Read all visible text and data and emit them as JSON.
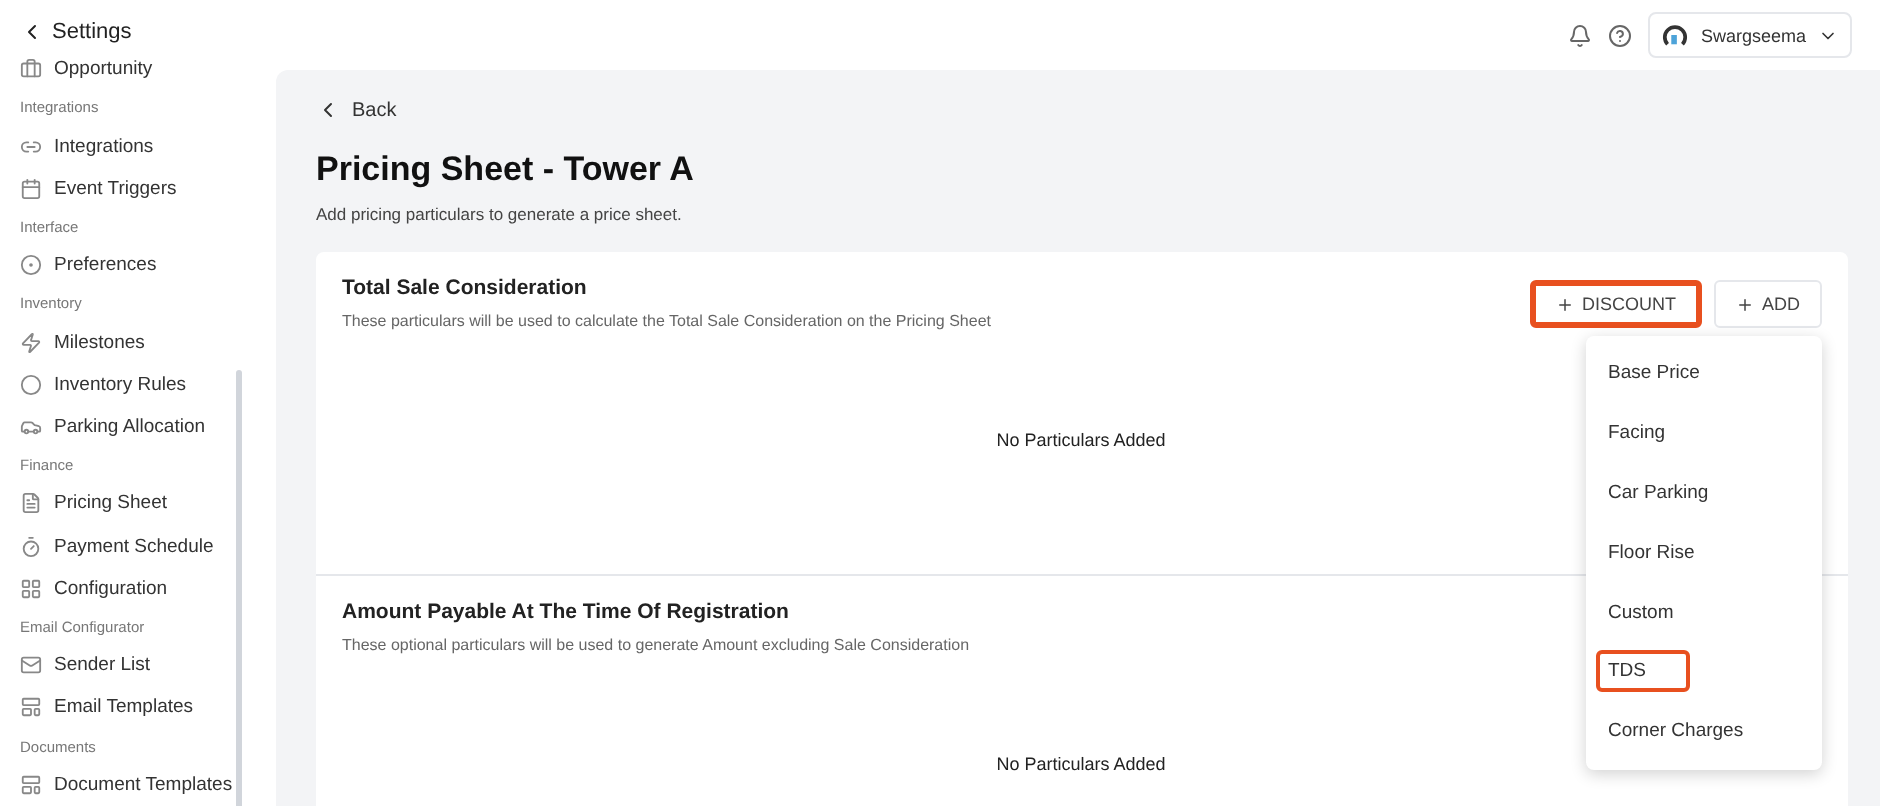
{
  "sidebar": {
    "back_label": "Settings",
    "items": [
      {
        "kind": "item",
        "label": "Opportunity"
      },
      {
        "kind": "section",
        "label": "Integrations"
      },
      {
        "kind": "item",
        "label": "Integrations"
      },
      {
        "kind": "item",
        "label": "Event Triggers"
      },
      {
        "kind": "section",
        "label": "Interface"
      },
      {
        "kind": "item",
        "label": "Preferences"
      },
      {
        "kind": "section",
        "label": "Inventory"
      },
      {
        "kind": "item",
        "label": "Milestones"
      },
      {
        "kind": "item",
        "label": "Inventory Rules"
      },
      {
        "kind": "item",
        "label": "Parking Allocation"
      },
      {
        "kind": "section",
        "label": "Finance"
      },
      {
        "kind": "item",
        "label": "Pricing Sheet"
      },
      {
        "kind": "item",
        "label": "Payment Schedule"
      },
      {
        "kind": "item",
        "label": "Configuration"
      },
      {
        "kind": "section",
        "label": "Email Configurator"
      },
      {
        "kind": "item",
        "label": "Sender List"
      },
      {
        "kind": "item",
        "label": "Email Templates"
      },
      {
        "kind": "section",
        "label": "Documents"
      },
      {
        "kind": "item",
        "label": "Document Templates"
      }
    ]
  },
  "topbar": {
    "user": "Swargseema"
  },
  "page": {
    "back": "Back",
    "title": "Pricing Sheet - Tower A",
    "subtitle": "Add pricing particulars to generate a price sheet.",
    "sections": [
      {
        "title": "Total Sale Consideration",
        "description": "These particulars will be used to calculate the Total Sale Consideration on the Pricing Sheet",
        "empty": "No Particulars Added"
      },
      {
        "title": "Amount Payable At The Time Of Registration",
        "description": "These optional particulars will be used to generate Amount excluding Sale Consideration",
        "empty": "No Particulars Added"
      }
    ],
    "buttons": [
      {
        "label": "DISCOUNT",
        "highlighted": true
      },
      {
        "label": "ADD",
        "highlighted": false
      }
    ],
    "menu": [
      {
        "label": "Base Price",
        "highlighted": false
      },
      {
        "label": "Facing",
        "highlighted": false
      },
      {
        "label": "Car Parking",
        "highlighted": false
      },
      {
        "label": "Floor Rise",
        "highlighted": false
      },
      {
        "label": "Custom",
        "highlighted": false
      },
      {
        "label": "TDS",
        "highlighted": true
      },
      {
        "label": "Corner Charges",
        "highlighted": false
      }
    ]
  }
}
